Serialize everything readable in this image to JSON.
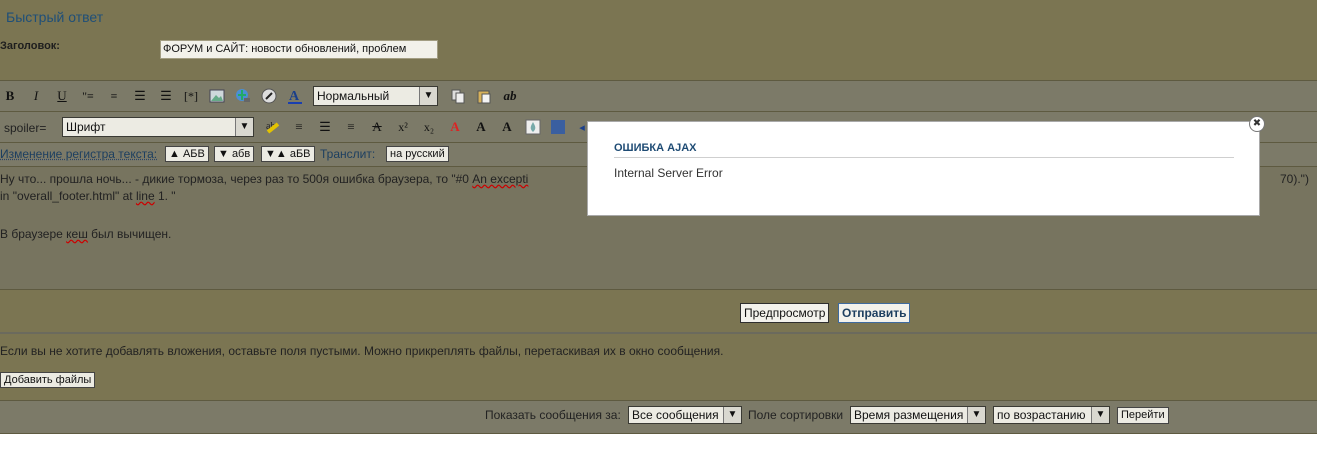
{
  "header": {
    "title": "Быстрый ответ"
  },
  "subject": {
    "label": "Заголовок:",
    "value": "ФОРУМ и САЙТ: новости обновлений, проблем"
  },
  "toolbar1": {
    "buttons": [
      "B",
      "I",
      "U"
    ],
    "size_select": "Нормальный"
  },
  "toolbar2": {
    "spoiler_label": "spoiler=",
    "font_select": "Шрифт"
  },
  "case_row": {
    "label": "Изменение регистра текста:",
    "btn_upper": "▲ АБВ",
    "btn_lower": "▼ абв",
    "btn_toggle": "▼▲ аБВ",
    "translit_label": "Транслит:",
    "translit_btn": "на русский"
  },
  "message": {
    "line1_a": "Ну что... прошла ночь... - дикие тормоза, через раз то 500я ошибка браузера, то \"#0 ",
    "line1_b": "An excepti",
    "line1_end": "70).\")",
    "line2_a": "in ",
    "line2_b": "\"overall_footer.html\" at ",
    "line2_c": "line",
    "line2_d": " 1. \"",
    "line3_a": "В браузере ",
    "line3_b": "кеш",
    "line3_c": " был вычищен."
  },
  "actions": {
    "preview": "Предпросмотр",
    "submit": "Отправить"
  },
  "attachments": {
    "note": "Если вы не хотите добавлять вложения, оставьте поля пустыми. Можно прикреплять файлы, перетаскивая их в окно сообщения.",
    "add_files": "Добавить файлы"
  },
  "footer": {
    "show_label": "Показать сообщения за:",
    "show_select": "Все сообщения",
    "sort_label": "Поле сортировки",
    "sort_select": "Время размещения",
    "order_select": "по возрастанию",
    "go": "Перейти"
  },
  "modal": {
    "title": "ОШИБКА AJAX",
    "message": "Internal Server Error",
    "close": "✖"
  }
}
